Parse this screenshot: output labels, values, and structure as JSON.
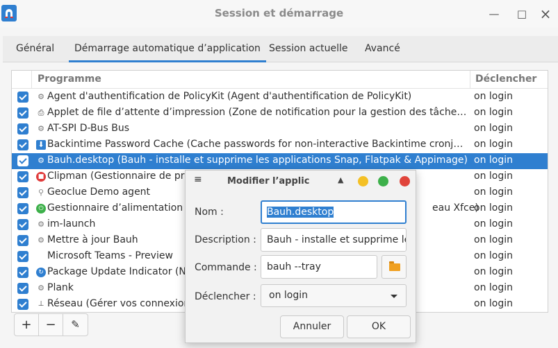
{
  "window": {
    "title": "Session et démarrage",
    "minimize": "—",
    "maximize": "□",
    "close": "×"
  },
  "tabs": [
    {
      "label": "Général"
    },
    {
      "label": "Démarrage automatique d’application"
    },
    {
      "label": "Session actuelle"
    },
    {
      "label": "Avancé"
    }
  ],
  "table": {
    "col_program": "Programme",
    "col_trigger": "Déclencher",
    "rows": [
      {
        "name": "Agent d'authentification de PolicyKit (Agent d'authentification de PolicyKit)",
        "trigger": "on login",
        "icon": "gear-icon",
        "glyph": "⚙"
      },
      {
        "name": "Applet de file d’attente d’impression (Zone de notification pour la gestion des tâches d’imp…",
        "trigger": "on login",
        "icon": "printer-icon",
        "glyph": "⎙"
      },
      {
        "name": "AT-SPI D-Bus Bus",
        "trigger": "on login",
        "icon": "gear-icon",
        "glyph": "⚙"
      },
      {
        "name": "Backintime Password Cache (Cache passwords for non-interactive Backintime cronjobs)",
        "trigger": "on login",
        "icon": "download-icon",
        "glyph": "⬇"
      },
      {
        "name": "Bauh.desktop (Bauh - installe et supprime les applications Snap, Flatpak & Appimage)",
        "trigger": "on login",
        "icon": "gear-icon",
        "glyph": "⚙"
      },
      {
        "name": "Clipman (Gestionnaire de pres",
        "trigger": "on login",
        "icon": "clipman-icon",
        "glyph": "■"
      },
      {
        "name": "Geoclue Demo agent",
        "trigger": "on login",
        "icon": "location-pin-icon",
        "glyph": "⚲"
      },
      {
        "name": "Gestionnaire d’alimentation (G",
        "trigger": "on login",
        "icon": "power-icon",
        "glyph": "⏻"
      },
      {
        "name": "im-launch",
        "trigger": "on login",
        "icon": "gear-icon",
        "glyph": "⚙"
      },
      {
        "name": "Mettre à jour Bauh",
        "trigger": "on login",
        "icon": "gear-icon",
        "glyph": "⚙"
      },
      {
        "name": "Microsoft Teams - Preview",
        "trigger": "on login",
        "icon": "",
        "glyph": ""
      },
      {
        "name": "Package Update Indicator (Not",
        "trigger": "on login",
        "icon": "package-update-icon",
        "glyph": "↻"
      },
      {
        "name": "Plank",
        "trigger": "on login",
        "icon": "gear-icon",
        "glyph": "⚙"
      },
      {
        "name": "Réseau (Gérer vos connexions",
        "trigger": "on login",
        "icon": "network-icon",
        "glyph": "⊥"
      }
    ],
    "obscured_trigger_suffix": "eau Xfce)"
  },
  "toolbar": {
    "add": "+",
    "remove": "−",
    "edit": "✎"
  },
  "dialog": {
    "menu": "≡",
    "title": "Modifier l’applic",
    "up": "▲",
    "name_label": "Nom :",
    "name_value": "Bauh.desktop",
    "description_label": "Description :",
    "description_value": "Bauh - installe et supprime les",
    "command_label": "Commande :",
    "command_value": "bauh --tray",
    "trigger_label": "Déclencher :",
    "trigger_value": "on login",
    "cancel": "Annuler",
    "ok": "OK",
    "colors": {
      "yellow": "#f4c025",
      "green": "#3db04a",
      "red": "#e0443b"
    }
  },
  "colors": {
    "accent": "#2f7fd0"
  }
}
